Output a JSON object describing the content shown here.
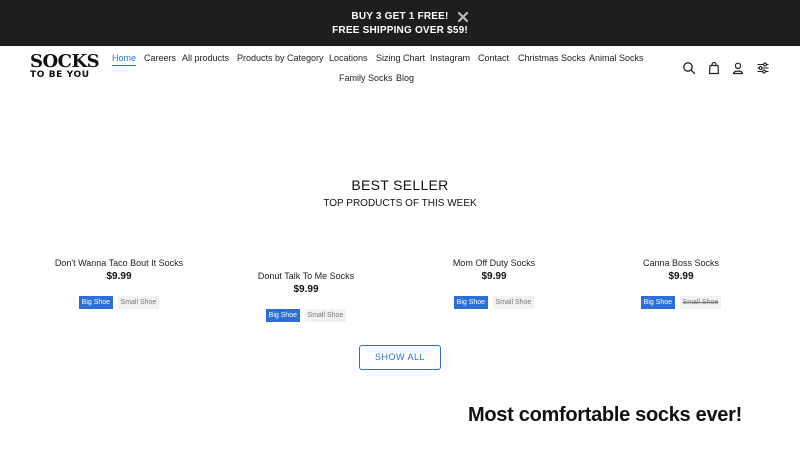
{
  "promo": {
    "line1": "BUY 3 GET 1 FREE!",
    "line2": "FREE SHIPPING OVER $59!",
    "close_icon": "close-icon"
  },
  "logo": {
    "top": "SOCKS",
    "bottom": "TO BE YOU"
  },
  "nav": {
    "active_color": "#2b6fd6",
    "items": [
      {
        "label": "Home",
        "active": true
      },
      {
        "label": "Careers"
      },
      {
        "label": "All products"
      },
      {
        "label": "Products by Category"
      },
      {
        "label": "Locations"
      },
      {
        "label": "Sizing Chart"
      },
      {
        "label": "Instagram"
      },
      {
        "label": "Contact"
      },
      {
        "label": "Christmas Socks"
      },
      {
        "label": "Animal Socks"
      },
      {
        "label": "Family Socks"
      },
      {
        "label": "Blog"
      }
    ]
  },
  "header_icons": [
    "search-icon",
    "bag-icon",
    "account-icon",
    "settings-sliders-icon"
  ],
  "best_seller": {
    "title": "BEST SELLER",
    "subtitle": "TOP PRODUCTS OF THIS WEEK"
  },
  "products": [
    {
      "name": "Don't Wanna Taco Bout It Socks",
      "price": "$9.99",
      "variants": [
        "Big Shoe",
        "Small Shoe"
      ]
    },
    {
      "name": "Donut Talk To Me Socks",
      "price": "$9.99",
      "variants": [
        "Big Shoe",
        "Small Shoe"
      ]
    },
    {
      "name": "Mom Off Duty Socks",
      "price": "$9.99",
      "variants": [
        "Big Shoe",
        "Small Shoe"
      ]
    },
    {
      "name": "Canna Boss Socks",
      "price": "$9.99",
      "variants": [
        "Big Shoe",
        "Small Shoe"
      ],
      "small_sold_out": true
    }
  ],
  "show_all_label": "SHOW ALL",
  "tagline": "Most comfortable socks ever!"
}
